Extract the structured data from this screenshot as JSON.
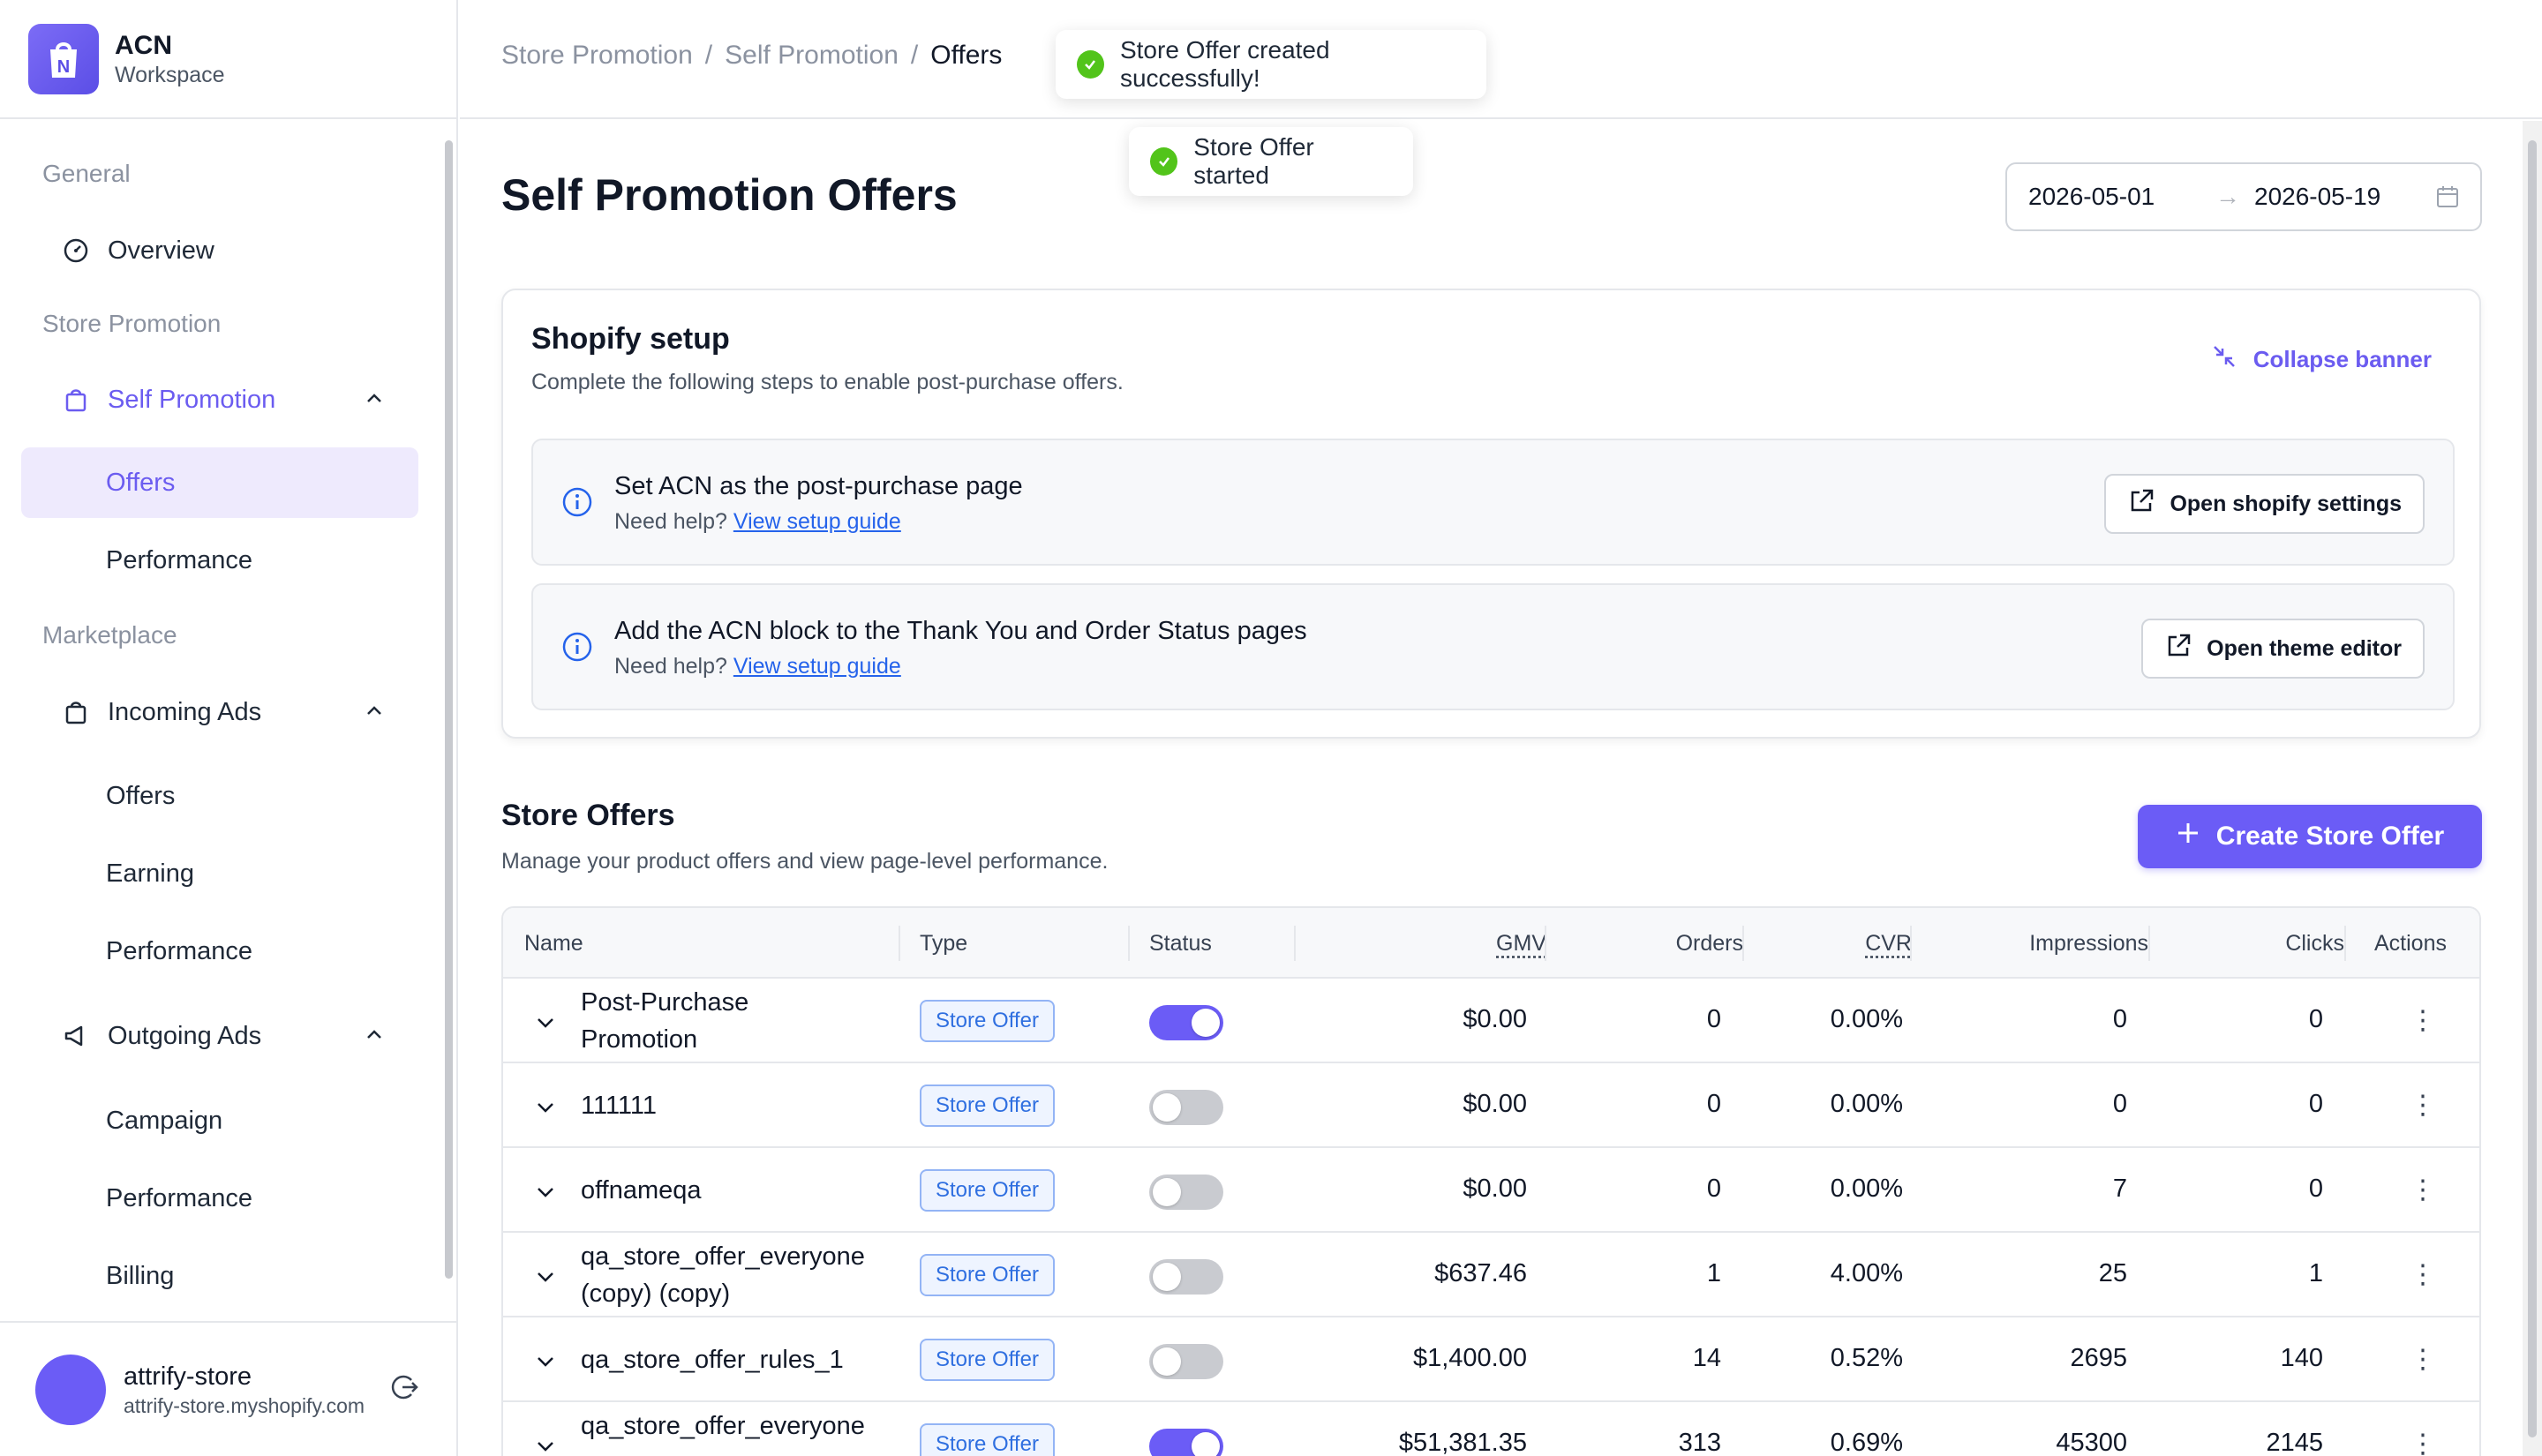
{
  "brand": {
    "name": "ACN",
    "subtitle": "Workspace"
  },
  "sidebar": {
    "sections": [
      {
        "label": "General"
      },
      {
        "label": "Store Promotion"
      },
      {
        "label": "Marketplace"
      }
    ],
    "items": {
      "overview": "Overview",
      "self_promotion": "Self Promotion",
      "sp_offers": "Offers",
      "sp_performance": "Performance",
      "incoming_ads": "Incoming Ads",
      "ia_offers": "Offers",
      "ia_earning": "Earning",
      "ia_performance": "Performance",
      "outgoing_ads": "Outgoing Ads",
      "oa_campaign": "Campaign",
      "oa_performance": "Performance",
      "oa_billing": "Billing"
    }
  },
  "user": {
    "name": "attrify-store",
    "domain": "attrify-store.myshopify.com"
  },
  "breadcrumb": {
    "items": [
      "Store Promotion",
      "Self Promotion",
      "Offers"
    ],
    "separator": "/"
  },
  "toasts": [
    "Store Offer created successfully!",
    "Store Offer started"
  ],
  "page": {
    "title": "Self Promotion Offers"
  },
  "date_range": {
    "start": "2026-05-01",
    "end": "2026-05-19",
    "arrow": "→"
  },
  "banner": {
    "title": "Shopify setup",
    "description": "Complete the following steps to enable post-purchase offers.",
    "collapse_label": "Collapse banner",
    "steps": [
      {
        "title": "Set ACN as the post-purchase page",
        "help": "Need help?",
        "link": "View setup guide",
        "button": "Open shopify settings"
      },
      {
        "title": "Add the ACN block to the Thank You and Order Status pages",
        "help": "Need help?",
        "link": "View setup guide",
        "button": "Open theme editor"
      }
    ]
  },
  "store_offers": {
    "title": "Store Offers",
    "description": "Manage your product offers and view page-level performance.",
    "create_label": "Create Store Offer"
  },
  "table": {
    "columns": [
      "Name",
      "Type",
      "Status",
      "GMV",
      "Orders",
      "CVR",
      "Impressions",
      "Clicks",
      "Actions"
    ],
    "rows": [
      {
        "name": "Post-Purchase Promotion",
        "type": "Store Offer",
        "enabled": true,
        "gmv": "$0.00",
        "orders": "0",
        "cvr": "0.00%",
        "impressions": "0",
        "clicks": "0"
      },
      {
        "name": "111111",
        "type": "Store Offer",
        "enabled": false,
        "gmv": "$0.00",
        "orders": "0",
        "cvr": "0.00%",
        "impressions": "0",
        "clicks": "0"
      },
      {
        "name": "offnameqa",
        "type": "Store Offer",
        "enabled": false,
        "gmv": "$0.00",
        "orders": "0",
        "cvr": "0.00%",
        "impressions": "7",
        "clicks": "0"
      },
      {
        "name": "qa_store_offer_everyone (copy) (copy)",
        "type": "Store Offer",
        "enabled": false,
        "gmv": "$637.46",
        "orders": "1",
        "cvr": "4.00%",
        "impressions": "25",
        "clicks": "1"
      },
      {
        "name": "qa_store_offer_rules_1",
        "type": "Store Offer",
        "enabled": false,
        "gmv": "$1,400.00",
        "orders": "14",
        "cvr": "0.52%",
        "impressions": "2695",
        "clicks": "140"
      },
      {
        "name": "qa_store_offer_everyone",
        "type": "Store Offer",
        "enabled": true,
        "gmv": "$51,381.35",
        "orders": "313",
        "cvr": "0.69%",
        "impressions": "45300",
        "clicks": "2145"
      }
    ]
  },
  "colors": {
    "accent": "#6b5cf6",
    "toast_success": "#52c41a",
    "badge_text": "#2f6fe0",
    "link": "#2563eb"
  }
}
